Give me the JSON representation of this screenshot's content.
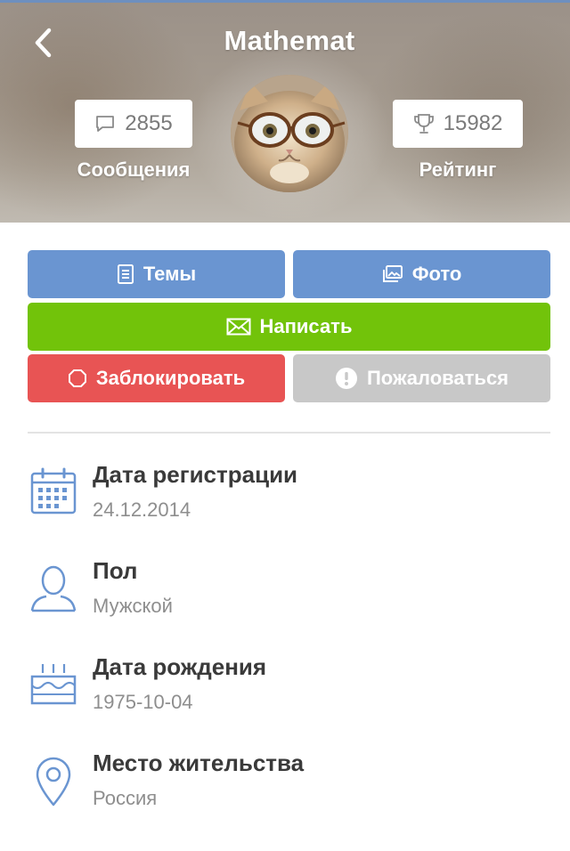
{
  "header": {
    "title": "Mathemat",
    "messages_count": "2855",
    "messages_label": "Сообщения",
    "rating_count": "15982",
    "rating_label": "Рейтинг"
  },
  "buttons": {
    "topics": "Темы",
    "photo": "Фото",
    "write": "Написать",
    "block": "Заблокировать",
    "report": "Пожаловаться"
  },
  "info": {
    "registration": {
      "label": "Дата регистрации",
      "value": "24.12.2014",
      "icon": "calendar-icon"
    },
    "gender": {
      "label": "Пол",
      "value": "Мужской",
      "icon": "user-icon"
    },
    "birthday": {
      "label": "Дата рождения",
      "value": "1975-10-04",
      "icon": "cake-icon"
    },
    "location": {
      "label": "Место жительства",
      "value": "Россия",
      "icon": "location-pin-icon"
    }
  },
  "colors": {
    "primary_blue": "#6a95d1",
    "write_green": "#72c30a",
    "block_red": "#e85454",
    "report_gray": "#c8c8c8",
    "icon_blue": "#6a95d1"
  }
}
